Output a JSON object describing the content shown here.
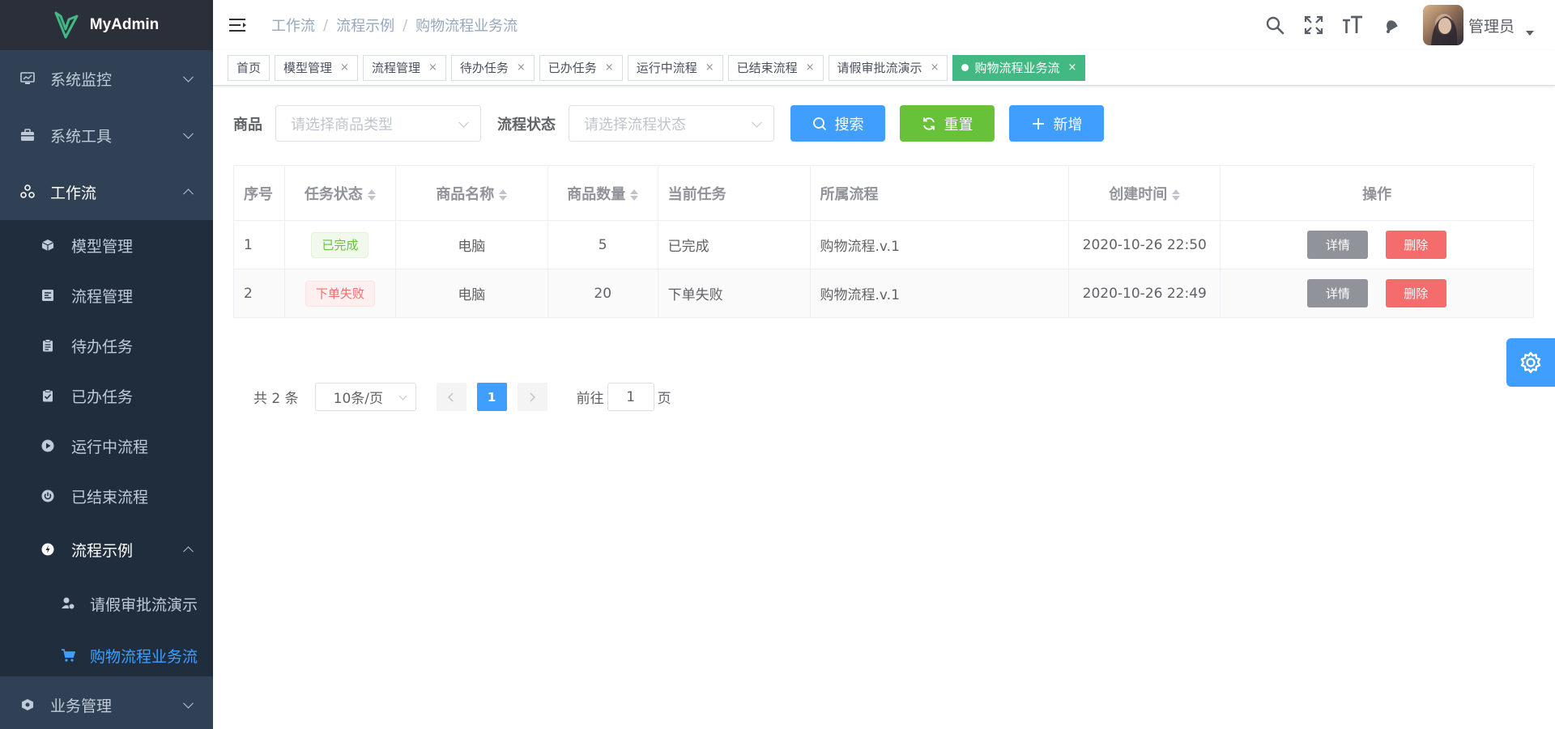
{
  "app": {
    "name": "MyAdmin"
  },
  "sidebar": {
    "menus": [
      {
        "label": "系统监控",
        "icon": "monitor-icon"
      },
      {
        "label": "系统工具",
        "icon": "toolbox-icon"
      },
      {
        "label": "工作流",
        "icon": "workflow-icon"
      }
    ],
    "workflow_items": [
      {
        "label": "模型管理",
        "icon": "cube-icon"
      },
      {
        "label": "流程管理",
        "icon": "process-icon"
      },
      {
        "label": "待办任务",
        "icon": "clipboard-icon"
      },
      {
        "label": "已办任务",
        "icon": "clipboard-check-icon"
      },
      {
        "label": "运行中流程",
        "icon": "play-icon"
      },
      {
        "label": "已结束流程",
        "icon": "power-icon"
      },
      {
        "label": "流程示例",
        "icon": "flow-example-icon"
      }
    ],
    "example_items": [
      {
        "label": "请假审批流演示",
        "icon": "users-icon"
      },
      {
        "label": "购物流程业务流",
        "icon": "cart-icon"
      }
    ],
    "bottom_menu": {
      "label": "业务管理",
      "icon": "business-icon"
    }
  },
  "navbar": {
    "breadcrumb": [
      "工作流",
      "流程示例",
      "购物流程业务流"
    ],
    "separator": "/",
    "user_name": "管理员"
  },
  "tags": [
    {
      "label": "首页",
      "closable": false
    },
    {
      "label": "模型管理",
      "closable": true
    },
    {
      "label": "流程管理",
      "closable": true
    },
    {
      "label": "待办任务",
      "closable": true
    },
    {
      "label": "已办任务",
      "closable": true
    },
    {
      "label": "运行中流程",
      "closable": true
    },
    {
      "label": "已结束流程",
      "closable": true
    },
    {
      "label": "请假审批流演示",
      "closable": true
    },
    {
      "label": "购物流程业务流",
      "closable": true,
      "active": true
    }
  ],
  "tag_close": "×",
  "filters": {
    "goods_label": "商品",
    "goods_placeholder": "请选择商品类型",
    "status_label": "流程状态",
    "status_placeholder": "请选择流程状态",
    "search_label": "搜索",
    "reset_label": "重置",
    "add_label": "新增"
  },
  "table": {
    "headers": {
      "index": "序号",
      "status": "任务状态",
      "goods_name": "商品名称",
      "quantity": "商品数量",
      "current_task": "当前任务",
      "process": "所属流程",
      "created": "创建时间",
      "actions": "操作"
    },
    "rows": [
      {
        "index": "1",
        "status": "已完成",
        "status_type": "success",
        "goods_name": "电脑",
        "quantity": "5",
        "current_task": "已完成",
        "process": "购物流程.v.1",
        "created": "2020-10-26 22:50"
      },
      {
        "index": "2",
        "status": "下单失败",
        "status_type": "danger",
        "goods_name": "电脑",
        "quantity": "20",
        "current_task": "下单失败",
        "process": "购物流程.v.1",
        "created": "2020-10-26 22:49"
      }
    ],
    "detail_label": "详情",
    "delete_label": "删除"
  },
  "pagination": {
    "total_text": "共 2 条",
    "page_size": "10条/页",
    "current_page": "1",
    "goto_label": "前往",
    "goto_value": "1",
    "page_suffix": "页"
  },
  "colors": {
    "sidebar_bg": "#304156",
    "primary": "#409eff",
    "success": "#67c23a",
    "danger": "#f56c6c",
    "active_tag": "#42b983"
  }
}
